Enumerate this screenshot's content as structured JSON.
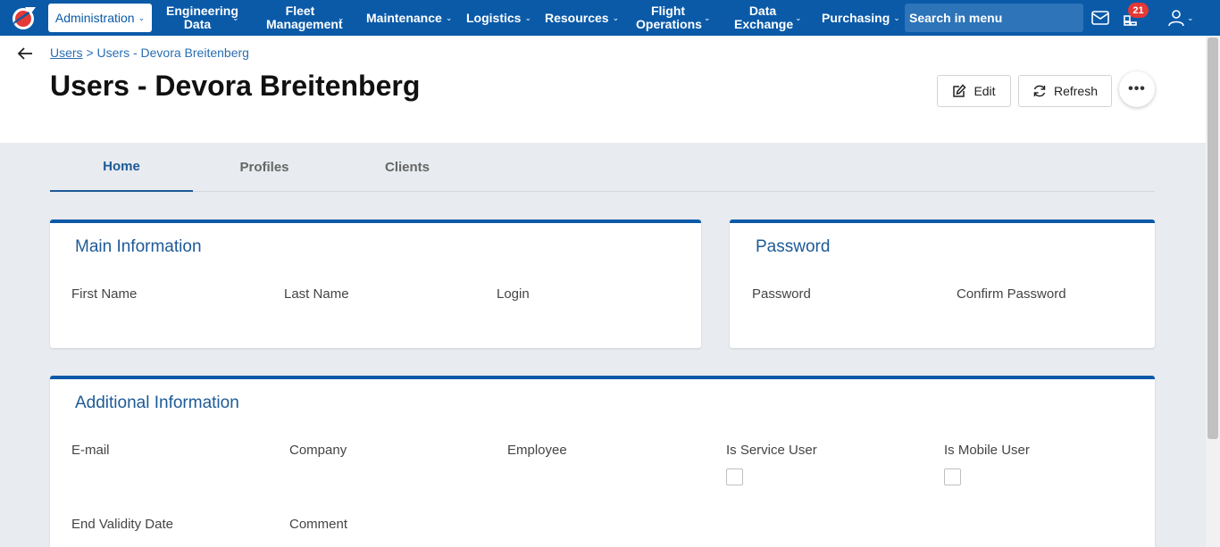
{
  "nav": {
    "items": [
      {
        "label": "Administration"
      },
      {
        "label": "Engineering Data"
      },
      {
        "label": "Fleet Management"
      },
      {
        "label": "Maintenance"
      },
      {
        "label": "Logistics"
      },
      {
        "label": "Resources"
      },
      {
        "label": "Flight Operations"
      },
      {
        "label": "Data Exchange"
      },
      {
        "label": "Purchasing"
      }
    ],
    "search_placeholder": "Search in menu",
    "notification_count": "21",
    "colors": {
      "bar": "#0a5aa8",
      "badge": "#e53935"
    }
  },
  "breadcrumb": {
    "root": "Users",
    "separator": ">",
    "current": "Users - Devora Breitenberg"
  },
  "page": {
    "title": "Users - Devora Breitenberg"
  },
  "actions": {
    "edit": "Edit",
    "refresh": "Refresh",
    "more": "•••"
  },
  "tabs": [
    {
      "label": "Home",
      "active": true
    },
    {
      "label": "Profiles",
      "active": false
    },
    {
      "label": "Clients",
      "active": false
    }
  ],
  "main_info": {
    "title": "Main Information",
    "fields": {
      "first_name": "First Name",
      "last_name": "Last Name",
      "login": "Login"
    }
  },
  "password": {
    "title": "Password",
    "fields": {
      "password": "Password",
      "confirm": "Confirm Password"
    }
  },
  "additional": {
    "title": "Additional Information",
    "fields": {
      "email": "E-mail",
      "company": "Company",
      "employee": "Employee",
      "service_user": "Is Service User",
      "mobile_user": "Is Mobile User",
      "end_validity": "End Validity Date",
      "comment": "Comment"
    },
    "service_user_checked": false,
    "mobile_user_checked": false
  }
}
